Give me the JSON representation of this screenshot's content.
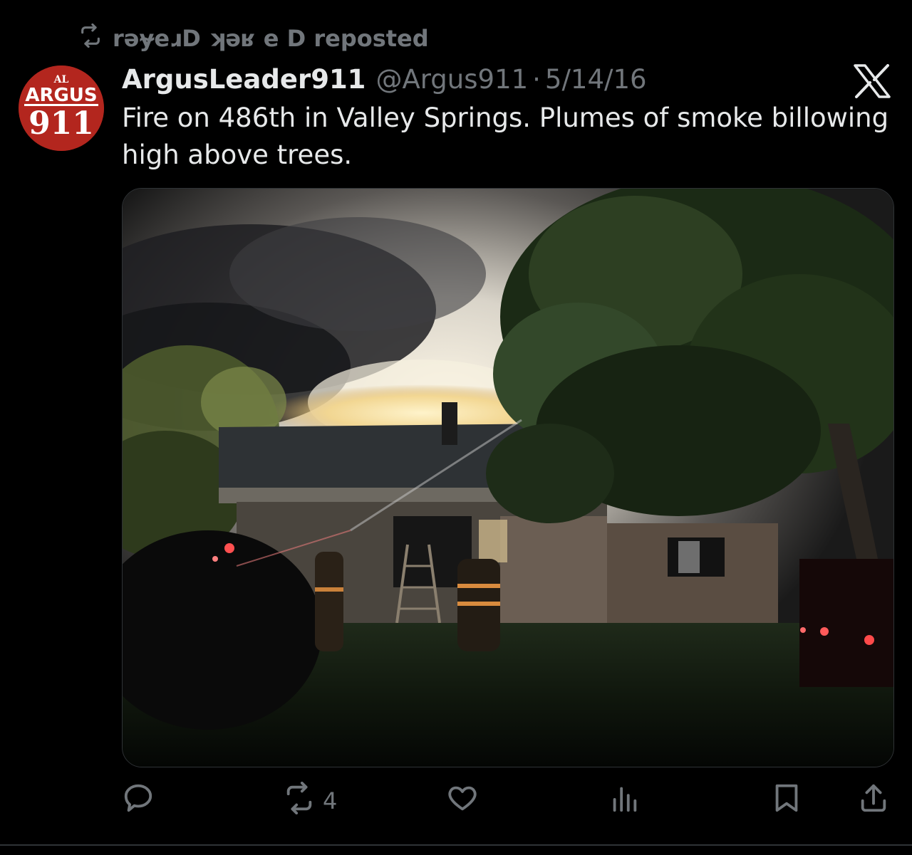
{
  "repost": {
    "icon": "repost-icon",
    "label": "rəy̴eɹD ʞəʁ e D reposted"
  },
  "avatar": {
    "icon": "argus-911-logo",
    "logo_text": [
      "AL",
      "ARGUS",
      "911"
    ],
    "color": "#b3261e"
  },
  "tweet": {
    "display_name": "ArgusLeader911",
    "handle": "@Argus911",
    "separator": "·",
    "date": "5/14/16",
    "text": "Fire on 486th in Valley Springs. Plumes of smoke billowing high above trees."
  },
  "header": {
    "platform_icon": "x-logo-icon"
  },
  "media": {
    "type": "photo",
    "subject": "house-fire-night-photo"
  },
  "actions": {
    "reply": {
      "icon": "reply-icon",
      "count": ""
    },
    "repost": {
      "icon": "repost-icon",
      "count": "4"
    },
    "like": {
      "icon": "heart-icon",
      "count": ""
    },
    "views": {
      "icon": "views-icon",
      "count": ""
    },
    "bookmark": {
      "icon": "bookmark-icon"
    },
    "share": {
      "icon": "share-icon"
    }
  },
  "colors": {
    "background": "#000000",
    "text_primary": "#e7e9ea",
    "text_secondary": "#71767b",
    "border": "#2f3336",
    "avatar_red": "#b3261e"
  }
}
